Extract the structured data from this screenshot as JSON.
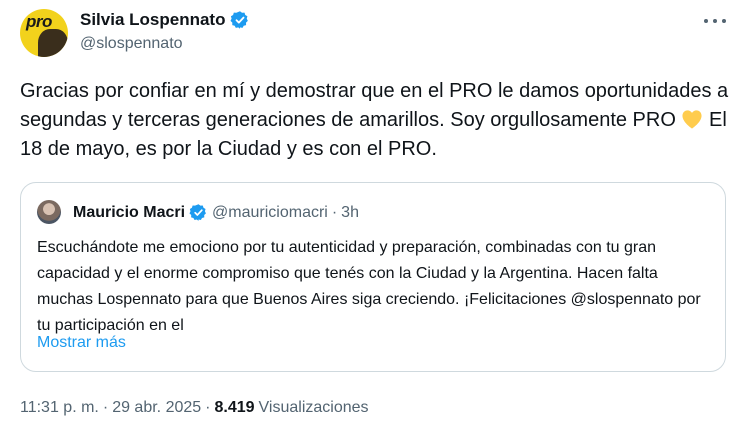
{
  "tweet": {
    "author": {
      "name": "Silvia Lospennato",
      "handle": "@slospennato",
      "avatar_logo_text": "pro"
    },
    "text_before_emoji": "Gracias por confiar en mí y demostrar que en el PRO le damos oportunidades a segundas y terceras generaciones de amarillos. Soy orgullosamente PRO ",
    "emoji": "yellow-heart",
    "text_after_emoji": " El 18 de mayo, es por la Ciudad y es con el PRO.",
    "time": "11:31 p. m.",
    "separator": "·",
    "date": "29 abr. 2025",
    "views_count": "8.419",
    "views_label": "Visualizaciones"
  },
  "quote": {
    "name": "Mauricio Macri",
    "handle": "@mauriciomacri",
    "separator": "·",
    "time": "3h",
    "text": "Escuchándote me emociono por tu autenticidad y preparación, combinadas con tu gran capacidad y el enorme compromiso que tenés con la Ciudad y la Argentina. Hacen falta muchas Lospennato para que Buenos Aires siga creciendo. ¡Felicitaciones @slospennato por tu participación en el",
    "show_more": "Mostrar más"
  },
  "colors": {
    "text": "#0f1419",
    "secondary": "#536471",
    "accent": "#1d9bf0",
    "border": "#cfd9de",
    "heart": "#ffcc4d"
  },
  "icons": [
    "verified-badge-icon",
    "more-options-icon",
    "yellow-heart-emoji"
  ]
}
